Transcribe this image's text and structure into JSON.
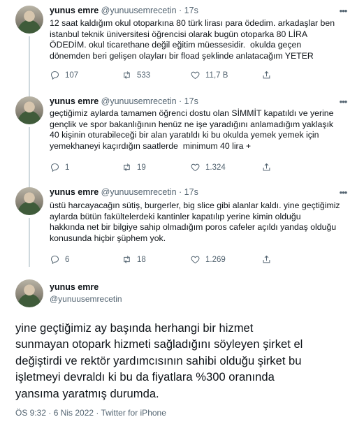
{
  "tweets": [
    {
      "name": "yunus emre",
      "handle": "@yunuusemrecetin",
      "time": "17s",
      "text": "12 saat kaldığım okul otoparkına 80 türk lirası para ödedim. arkadaşlar ben\nistanbul teknik üniversitesi öğrencisi olarak bugün otoparka 80 LİRA\nÖDEDİM. okul ticarethane değil eğitim müessesidir.  okulda geçen\ndönemden beri gelişen olayları bir fload şeklinde anlatacağım YETER",
      "replies": "107",
      "retweets": "533",
      "likes": "11,7 B"
    },
    {
      "name": "yunus emre",
      "handle": "@yunuusemrecetin",
      "time": "17s",
      "text": "geçtiğimiz aylarda tamamen öğrenci dostu olan SİMMİT kapatıldı ve yerine\ngençlik ve spor bakanlığının henüz ne işe yaradığını anlamadığım yaklaşık\n40 kişinin oturabileceği bir alan yaratıldı ki bu okulda yemek yemek için\nyemekhaneyi kaçırdığın saatlerde  minimum 40 lira +",
      "replies": "1",
      "retweets": "19",
      "likes": "1.324"
    },
    {
      "name": "yunus emre",
      "handle": "@yunuusemrecetin",
      "time": "17s",
      "text": "üstü harcayacağın sütiş, burgerler, big slice gibi alanlar kaldı. yine geçtiğimiz\naylarda bütün fakültelerdeki kantinler kapatılıp yerine kimin olduğu\nhakkında net bir bilgiye sahip olmadığım poros cafeler açıldı yandaş olduğu\nkonusunda hiçbir şüphem yok.",
      "replies": "6",
      "retweets": "18",
      "likes": "1.269"
    }
  ],
  "main_tweet": {
    "name": "yunus emre",
    "handle": "@yunuusemrecetin",
    "text": "yine geçtiğimiz ay başında herhangi bir hizmet\nsunmayan otopark hizmeti sağladığını söyleyen şirket el\ndeğiştirdi ve rektör yardımcısının sahibi olduğu şirket bu\nişletmeyi devraldı ki bu da fiyatlara %300 oranında\nyansıma yaratmış durumda.",
    "meta": "ÖS 9:32 · 6 Nis 2022 · Twitter for iPhone"
  },
  "icons": {
    "more": "more-dots-icon",
    "reply": "reply-icon",
    "retweet": "retweet-icon",
    "like": "heart-icon",
    "share": "share-icon"
  },
  "colors": {
    "text": "#0f1419",
    "secondary": "#536471",
    "thread_line": "#cfd9de"
  }
}
